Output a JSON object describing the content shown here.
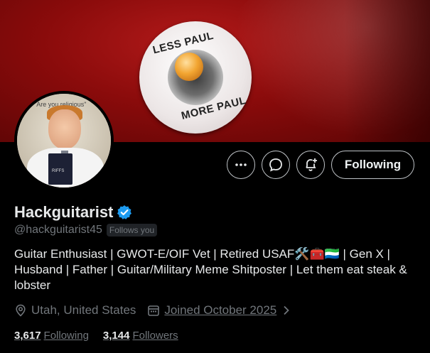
{
  "banner": {
    "plate_top_text": "LESS PAUL",
    "plate_bottom_text": "MORE PAUL"
  },
  "avatar": {
    "caption": "\"Are you religious\"",
    "book_text": "RIFFS"
  },
  "actions": {
    "more_icon": "more-horizontal-icon",
    "message_icon": "message-bubble-icon",
    "notify_icon": "bell-plus-icon",
    "follow_label": "Following"
  },
  "profile": {
    "name": "Hackguitarist",
    "handle": "@hackguitarist45",
    "follows_you": "Follows you",
    "bio": "Guitar Enthusiast | GWOT-E/OIF Vet | Retired USAF🛠️🧰🇸🇱 | Gen X | Husband | Father | Guitar/Military Meme Shitposter | Let them eat steak & lobster",
    "location": "Utah, United States",
    "joined": "Joined October 2025"
  },
  "stats": {
    "following_count": "3,617",
    "following_label": "Following",
    "followers_count": "3,144",
    "followers_label": "Followers"
  },
  "colors": {
    "background": "#000000",
    "verified": "#1d9bf0",
    "secondary_text": "#71767b",
    "primary_text": "#e7e9ea"
  }
}
